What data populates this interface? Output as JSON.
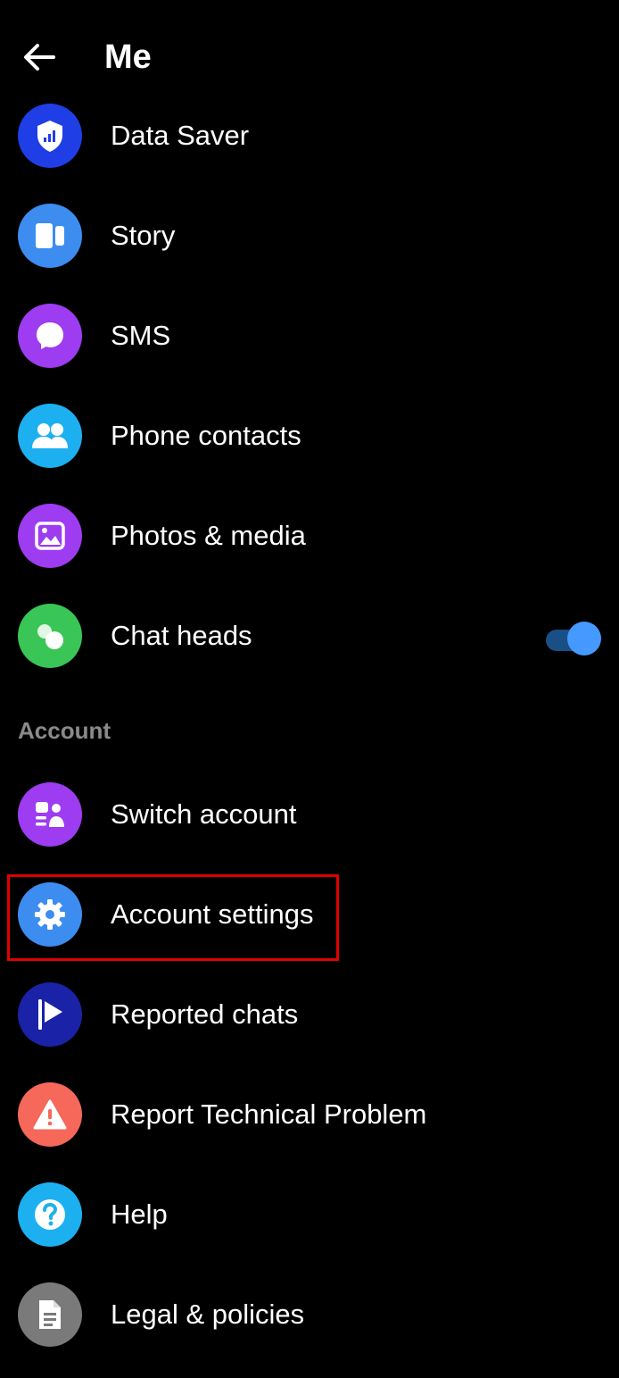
{
  "header": {
    "title": "Me"
  },
  "settings": {
    "items": [
      {
        "label": "Data Saver",
        "color": "#1f3ee6",
        "icon": "shield-signal-icon"
      },
      {
        "label": "Story",
        "color": "#3d8cf0",
        "icon": "story-icon"
      },
      {
        "label": "SMS",
        "color": "#9d3cf0",
        "icon": "chat-bubble-icon"
      },
      {
        "label": "Phone contacts",
        "color": "#1db0f0",
        "icon": "people-icon"
      },
      {
        "label": "Photos & media",
        "color": "#9d3cf0",
        "icon": "image-icon"
      },
      {
        "label": "Chat heads",
        "color": "#39c656",
        "icon": "chat-heads-icon",
        "toggle_on": true
      }
    ]
  },
  "account": {
    "section_label": "Account",
    "items": [
      {
        "label": "Switch account",
        "color": "#9d3cf0",
        "icon": "switch-account-icon"
      },
      {
        "label": "Account settings",
        "color": "#3d8cf0",
        "icon": "gear-icon"
      },
      {
        "label": "Reported chats",
        "color": "#1a22a8",
        "icon": "flag-icon"
      },
      {
        "label": "Report Technical Problem",
        "color": "#f5685a",
        "icon": "warning-icon"
      },
      {
        "label": "Help",
        "color": "#1db0f0",
        "icon": "help-icon"
      },
      {
        "label": "Legal & policies",
        "color": "#7a7a7a",
        "icon": "document-icon"
      }
    ]
  },
  "accent_color": "#4599ff",
  "highlight_color": "#e00000"
}
